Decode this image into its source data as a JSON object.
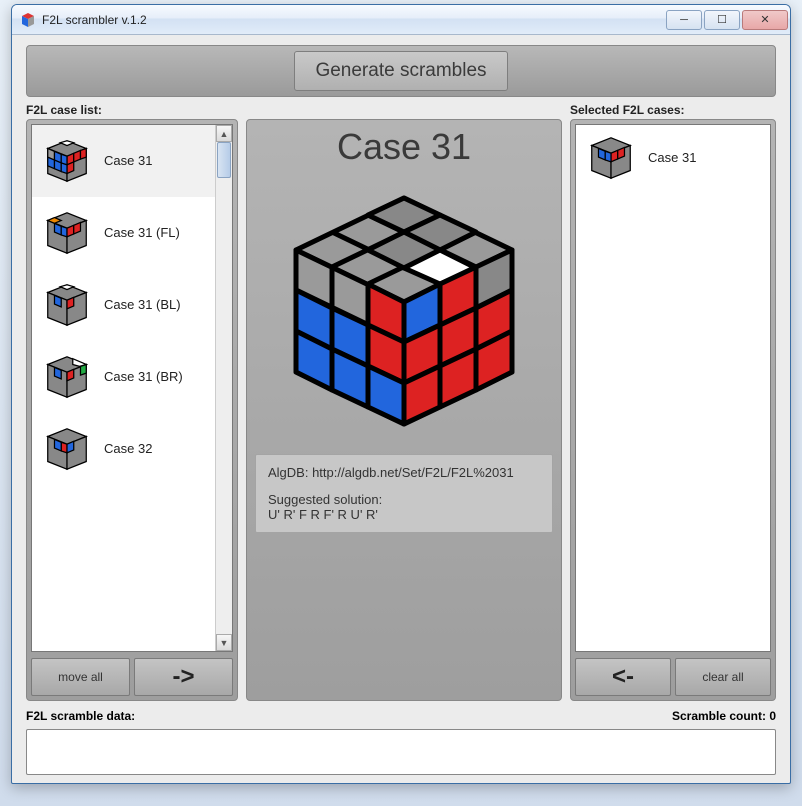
{
  "window": {
    "title": "F2L scrambler v.1.2"
  },
  "generate_button": "Generate scrambles",
  "labels": {
    "case_list": "F2L case list:",
    "selected_cases": "Selected F2L cases:",
    "scramble_data": "F2L scramble data:",
    "scramble_count": "Scramble count: 0"
  },
  "buttons": {
    "move_all": "move all",
    "move_right": "->",
    "move_left": "<-",
    "clear_all": "clear all"
  },
  "case_list": [
    {
      "label": "Case 31"
    },
    {
      "label": "Case 31 (FL)"
    },
    {
      "label": "Case 31 (BL)"
    },
    {
      "label": "Case 31 (BR)"
    },
    {
      "label": "Case 32"
    }
  ],
  "selected_list": [
    {
      "label": "Case 31"
    }
  ],
  "center": {
    "title": "Case 31",
    "algdb_label": "AlgDB: http://algdb.net/Set/F2L/F2L%2031",
    "solution_label": "Suggested solution:",
    "solution": "U' R' F R F' R U' R'"
  }
}
